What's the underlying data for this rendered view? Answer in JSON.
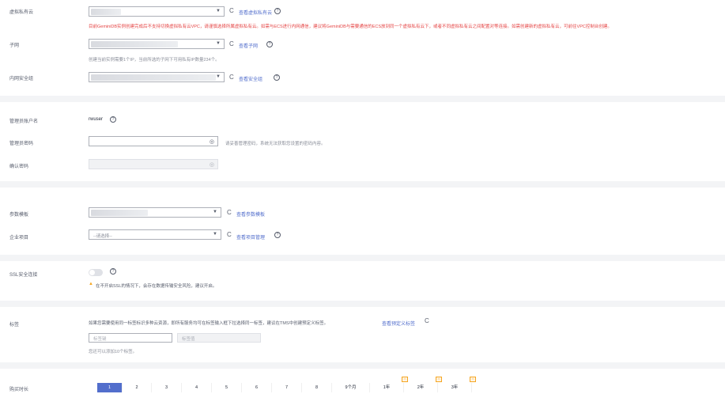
{
  "vpc": {
    "label": "虚拟私有云",
    "value": "",
    "link": "查看虚拟私有云",
    "warning": "目前GeminiDB实例创建完成后不支持切换虚拟私有云VPC，请谨慎选择所属虚拟私有云。如需与ECS进行内网通信，建议将GeminiDB与需要通信的ECS放到同一个虚拟私有云下，或者不同虚拟私有云之间配置对等连接。如需创建新的虚拟私有云，可前往VPC控制台创建。"
  },
  "subnet": {
    "label": "子网",
    "value": "",
    "link": "查看子网",
    "hint": "创建当前实例需要1个IP，当前所选的子网下可用私有IP数量234个。"
  },
  "security_group": {
    "label": "内网安全组",
    "value": "",
    "link": "查看安全组"
  },
  "admin": {
    "label": "管理员账户名",
    "value": "rwuser"
  },
  "password": {
    "label": "管理员密码",
    "value": "",
    "hint": "请妥善管理密码，系统无法获取您设置的密码内容。"
  },
  "confirm_password": {
    "label": "确认密码",
    "value": ""
  },
  "param_template": {
    "label": "参数模板",
    "value": "",
    "link": "查看参数模板"
  },
  "enterprise_project": {
    "label": "企业项目",
    "placeholder": "--请选择--",
    "link": "查看项目管理"
  },
  "ssl": {
    "label": "SSL安全连接",
    "enabled": false,
    "warning": "在不开启SSL的情况下，会存在数据传输安全风险，建议开启。"
  },
  "tags": {
    "label": "标签",
    "desc": "如果您需要使用同一标签标识多种云资源，即所有服务均可在标签输入框下拉选择同一标签，建议在TMS中创建预定义标签。",
    "link": "查看预定义标签",
    "key_placeholder": "标签键",
    "value_placeholder": "标签值",
    "hint": "您还可以添加10个标签。"
  },
  "duration": {
    "label": "购买时长",
    "options": [
      "1",
      "2",
      "3",
      "4",
      "5",
      "6",
      "7",
      "8",
      "9个月",
      "1年",
      "2年",
      "3年"
    ],
    "selected": "1",
    "promo_options": [
      "1年",
      "2年",
      "3年"
    ]
  },
  "colors": {
    "accent": "#526ecc",
    "warning_red": "#e54545",
    "warning_orange": "#f5a623"
  }
}
